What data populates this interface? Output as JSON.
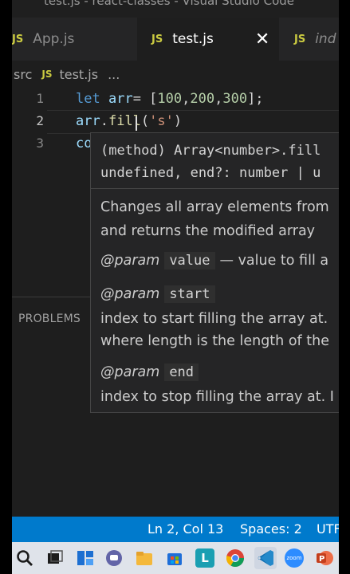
{
  "window": {
    "title": "test.js - react-classes - Visual Studio Code"
  },
  "tabs": [
    {
      "badge": "JS",
      "label": "App.js"
    },
    {
      "badge": "JS",
      "label": "test.js",
      "close": "✕"
    },
    {
      "badge": "JS",
      "label": "ind"
    }
  ],
  "breadcrumb": {
    "folder": "src",
    "badge": "JS",
    "file": "test.js",
    "more": "..."
  },
  "editor": {
    "line_numbers": [
      "1",
      "2",
      "3"
    ],
    "line1": {
      "kw": "let",
      "var": "arr",
      "eq": "= [",
      "n1": "100",
      "c1": ",",
      "n2": "200",
      "c2": ",",
      "n3": "300",
      "end": "];"
    },
    "line2": {
      "var": "arr",
      "dot": ".",
      "fn": "fill",
      "p1": "(",
      "str": "'s'",
      "p2": ")"
    },
    "line3": {
      "partial": "co"
    }
  },
  "hover": {
    "sig_line1": "(method) Array<number>.fill",
    "sig_line2": "undefined, end?: number | u",
    "doc_line1": "Changes all array elements from",
    "doc_line2": "and returns the modified array",
    "params": [
      {
        "tag": "@param",
        "name": "value",
        "desc": "— value to fill a"
      },
      {
        "tag": "@param",
        "name": "start",
        "desc_line1": "index to start filling the array at.",
        "desc_line2": "where length is the length of the"
      },
      {
        "tag": "@param",
        "name": "end",
        "desc_line1": "index to stop filling the array at. I"
      }
    ]
  },
  "panel": {
    "problems_label": "PROBLEMS"
  },
  "statusbar": {
    "position": "Ln 2, Col 13",
    "spaces": "Spaces: 2",
    "encoding": "UTF"
  },
  "taskbar": {
    "icons": [
      "search-icon",
      "task-view-icon",
      "widgets-icon",
      "teams-chat-icon",
      "file-explorer-icon",
      "store-icon",
      "launcher-icon",
      "chrome-icon",
      "vscode-icon",
      "zoom-icon",
      "powerpoint-icon"
    ],
    "zoom_label": "zoom",
    "launcher_letter": "L"
  },
  "colors": {
    "statusbar": "#007acc",
    "editor_bg": "#1e1e1e",
    "taskbar": "#dfe3ea"
  }
}
